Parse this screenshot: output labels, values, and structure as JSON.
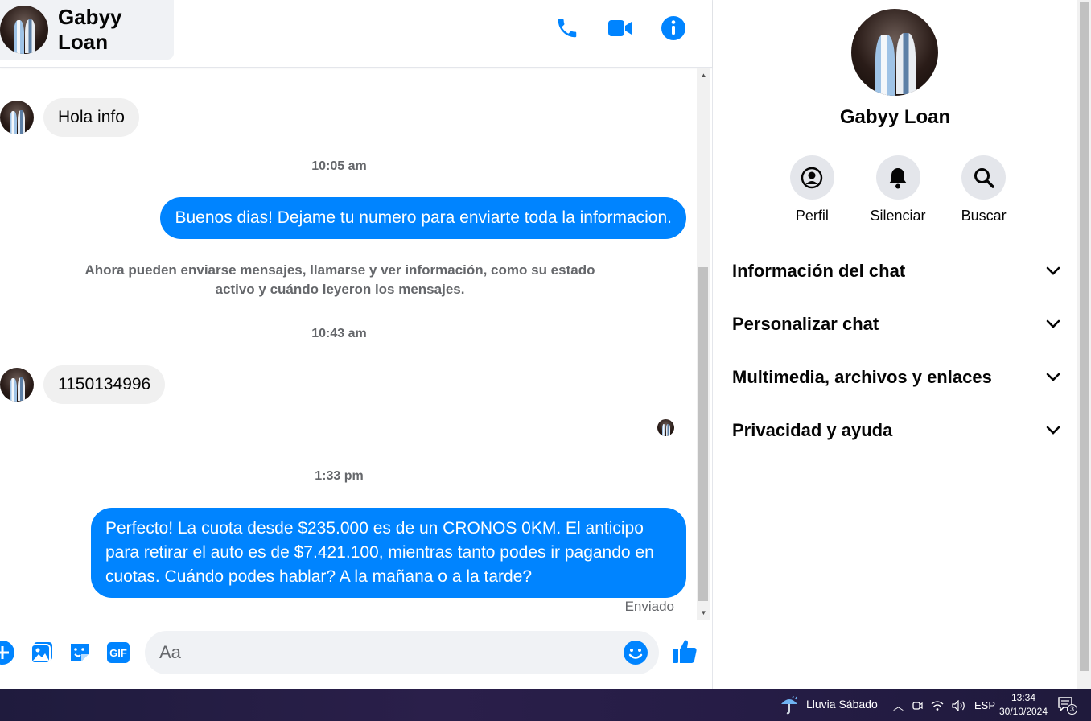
{
  "contact": {
    "name": "Gabyy Loan"
  },
  "header_actions": [
    "phone-icon",
    "video-call-icon",
    "info-icon"
  ],
  "messages": [
    {
      "type": "incoming",
      "text": "Hola info"
    },
    {
      "type": "time",
      "text": "10:05 am"
    },
    {
      "type": "outgoing",
      "text": "Buenos dias! Dejame tu numero para enviarte toda la informacion."
    },
    {
      "type": "notice",
      "text": "Ahora pueden enviarse mensajes, llamarse y ver información, como su estado activo y cuándo leyeron los mensajes."
    },
    {
      "type": "time",
      "text": "10:43 am"
    },
    {
      "type": "incoming",
      "text": "1150134996"
    },
    {
      "type": "time",
      "text": "1:33 pm"
    },
    {
      "type": "outgoing",
      "text": "Perfecto! La cuota desde $235.000 es de un CRONOS 0KM. El anticipo para retirar el auto es de $7.421.100, mientras tanto podes ir pagando en cuotas. Cuándo podes hablar? A la mañana o a la tarde?"
    }
  ],
  "sent_status": "Enviado",
  "composer": {
    "placeholder": "Aa",
    "value": ""
  },
  "panel": {
    "name": "Gabyy Loan",
    "actions": [
      {
        "label": "Perfil",
        "icon": "profile-icon"
      },
      {
        "label": "Silenciar",
        "icon": "bell-icon"
      },
      {
        "label": "Buscar",
        "icon": "search-icon"
      }
    ],
    "sections": [
      "Información del chat",
      "Personalizar chat",
      "Multimedia, archivos y enlaces",
      "Privacidad y ayuda"
    ]
  },
  "taskbar": {
    "weather": "Lluvia Sábado",
    "language": "ESP",
    "time": "13:34",
    "date": "30/10/2024",
    "notifications": "3"
  },
  "colors": {
    "accent": "#0084ff",
    "bubble_in": "#f0f0f0",
    "muted": "#65676b"
  }
}
